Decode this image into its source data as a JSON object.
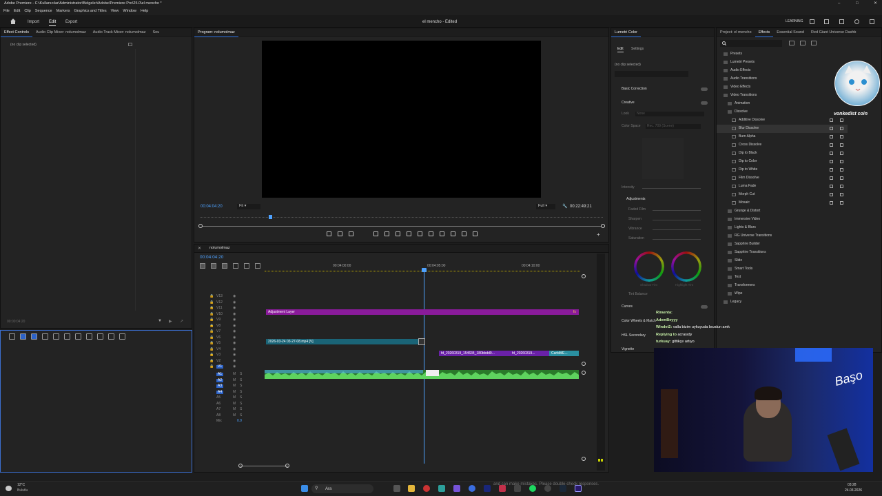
{
  "titlebar": {
    "title": "Adobe Premiere - C:\\Kullanıcılar\\Administrator\\Belgeler\\Adobe\\Premiere Pro\\25.0\\el mencho *"
  },
  "menu": [
    "File",
    "Edit",
    "Clip",
    "Sequence",
    "Markers",
    "Graphics and Titles",
    "View",
    "Window",
    "Help"
  ],
  "workspace": {
    "home": "Home",
    "import": "Import",
    "edit": "Edit",
    "export": "Export",
    "project_title": "el mencho",
    "status": "Edited",
    "learning": "LEARNING"
  },
  "left_panel": {
    "tabs": [
      "Effect Controls",
      "Audio Clip Mixer: nolumolmaz",
      "Audio Track Mixer: nolumolmaz",
      "Sou"
    ],
    "no_clip": "(no clip selected)",
    "timecode": "00:00:04:20"
  },
  "program": {
    "tab": "Program: nolumolmaz",
    "timecode": "00:04:04:20",
    "fit": "Fit",
    "quality": "Full",
    "duration": "00:22:49:21"
  },
  "timeline": {
    "seq_name": "nolumolmaz",
    "timecode": "00:04:04:20",
    "ruler": [
      "00:04:00:00",
      "00:04:05:00",
      "00:04:10:00"
    ],
    "video_tracks": [
      "V13",
      "V12",
      "V11",
      "V10",
      "V9",
      "V8",
      "V7",
      "V6",
      "V5",
      "V4",
      "V3",
      "V2",
      "V1"
    ],
    "audio_tracks": [
      "A1",
      "A2",
      "A3",
      "A4",
      "A5",
      "A6",
      "A7",
      "A8"
    ],
    "mix_label": "Mix",
    "mix_value": "0.0",
    "clips": {
      "adjustment": "Adjustment Layer",
      "video1": "2026-03-24 03-27-08.mp4 [V]",
      "video2": "fd_20260319_154634_180bbdd9...",
      "video3": "fd_20260319...",
      "video4": "CarbiME..."
    }
  },
  "lumetri": {
    "tab": "Lumetri Color",
    "edit": "Edit",
    "settings": "Settings",
    "no_clip": "(no clip selected)",
    "sections": {
      "basic": "Basic Correction",
      "creative": "Creative",
      "look": "Look",
      "look_val": "None",
      "colorspace": "Color Space",
      "colorspace_val": "Rec. 709 (Scene)",
      "intensity": "Intensity",
      "adjustments": "Adjustments",
      "faded": "Faded Film",
      "sharpen": "Sharpen",
      "vibrance": "Vibrance",
      "saturation": "Saturation",
      "shadow": "Shadow Tint",
      "highlight": "Highlight Tint",
      "tint_balance": "Tint Balance",
      "curves": "Curves",
      "wheels": "Color Wheels & Match",
      "hsl": "HSL Secondary",
      "vignette": "Vignette"
    }
  },
  "effects": {
    "tabs": [
      "Project: el mencho",
      "Effects",
      "Essential Sound",
      "Red Giant Universe Dashb"
    ],
    "tree": [
      "Presets",
      "Lumetri Presets",
      "Audio Effects",
      "Audio Transitions",
      "Video Effects",
      "Video Transitions",
      "Animation",
      "Dissolve",
      "Additive Dissolve",
      "Blur Dissolve",
      "Burn Alpha",
      "Cross Dissolve",
      "Dip to Black",
      "Dip to Color",
      "Dip to White",
      "Film Dissolve",
      "Luma Fade",
      "Morph Cut",
      "Mosaic",
      "Grunge & Distort",
      "Immersive Video",
      "Lights & Blurs",
      "RG Universe Transitions",
      "Sapphire Builder",
      "Sapphire Transitions",
      "Slide",
      "Smart Tools",
      "Text",
      "Transformers",
      "Wipe",
      "Legacy"
    ]
  },
  "overlay": {
    "brand": "vonkedist coin",
    "cam_sign": "Başo",
    "chat": [
      {
        "user": "Riraenta:",
        "msg": ""
      },
      {
        "user": "AdemBeyyy",
        "msg": ""
      },
      {
        "user": "Windet2:",
        "msg": "valla bizim uykuyuda bozdun amk"
      },
      {
        "user": "Replying to",
        "msg": "acrasıdy"
      },
      {
        "user": "turkuay:",
        "msg": "gittikçe artıyo"
      }
    ]
  },
  "taskbar": {
    "temp": "12°C",
    "weather": "Bulutlu",
    "search": "Ara",
    "time": "03:28",
    "date": "24.03.2026",
    "notice": "and can make mistakes. Please double-check responses."
  }
}
